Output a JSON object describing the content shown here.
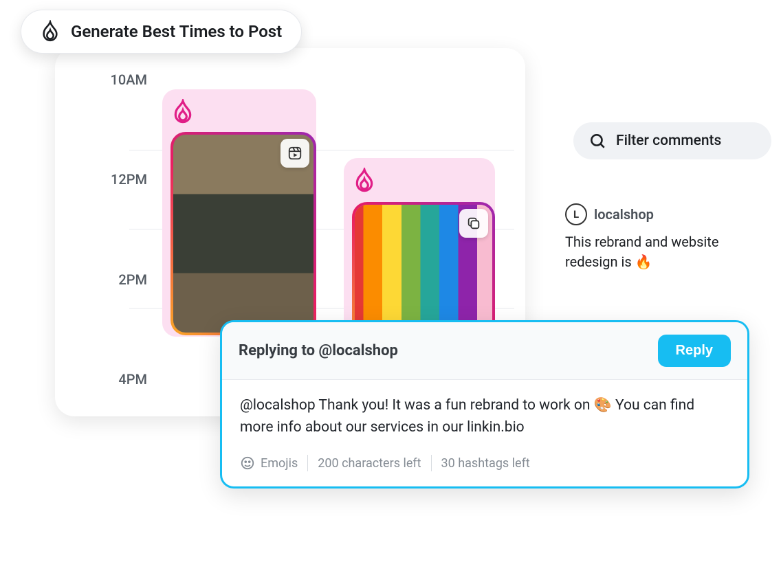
{
  "pill": {
    "label": "Generate Best Times to Post"
  },
  "timeAxis": [
    "10AM",
    "12PM",
    "2PM",
    "4PM"
  ],
  "filter": {
    "label": "Filter comments"
  },
  "comment": {
    "user": "localshop",
    "avatarInitial": "L",
    "body": "This rebrand and website redesign is 🔥"
  },
  "composer": {
    "title": "Replying to @localshop",
    "replyLabel": "Reply",
    "body": "@localshop Thank you! It was a fun rebrand to work on 🎨 You can find more info about our services in our linkin.bio",
    "emojisLabel": "Emojis",
    "charsLeft": "200 characters left",
    "hashtagsLeft": "30 hashtags left"
  }
}
